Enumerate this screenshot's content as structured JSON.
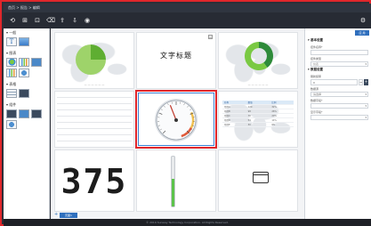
{
  "breadcrumb": "首页 > 报告 > 编辑",
  "toolbar": {
    "buttons": [
      {
        "name": "undo-button",
        "glyph": "⟲"
      },
      {
        "name": "new-page-button",
        "glyph": "⊞"
      },
      {
        "name": "preview-button",
        "glyph": "⊡"
      },
      {
        "name": "clear-button",
        "glyph": "⌫"
      },
      {
        "name": "import-button",
        "glyph": "⇪"
      },
      {
        "name": "export-button",
        "glyph": "⇩"
      },
      {
        "name": "view-button",
        "glyph": "◉"
      }
    ],
    "settings_glyph": "⚙"
  },
  "left_panel": {
    "sections": [
      {
        "title": "▾ 一般",
        "items": [
          {
            "name": "text-tool-icon",
            "glyph": "T",
            "cls": ""
          },
          {
            "name": "image-tool-icon",
            "glyph": "",
            "cls": "img"
          }
        ]
      },
      {
        "title": "▾ 图表",
        "items": [
          {
            "name": "pie-chart-tool-icon",
            "glyph": "",
            "cls": "pie"
          },
          {
            "name": "bar-chart-tool-icon",
            "glyph": "",
            "cls": "chart"
          },
          {
            "name": "gauge-chart-tool-icon",
            "glyph": "",
            "cls": "blue"
          },
          {
            "name": "line-chart-tool-icon",
            "glyph": "",
            "cls": "chart"
          },
          {
            "name": "map-chart-tool-icon",
            "glyph": "",
            "cls": "globe"
          }
        ]
      },
      {
        "title": "▾ 表格",
        "items": [
          {
            "name": "table-tool-icon",
            "glyph": "",
            "cls": "tbl"
          },
          {
            "name": "grid-table-tool-icon",
            "glyph": "",
            "cls": "dark"
          }
        ]
      },
      {
        "title": "▾ 组件",
        "items": [
          {
            "name": "component-tool-icon",
            "glyph": "",
            "cls": "dark"
          },
          {
            "name": "component-2-tool-icon",
            "glyph": "",
            "cls": "blue"
          },
          {
            "name": "component-3-tool-icon",
            "glyph": "",
            "cls": "dark"
          },
          {
            "name": "component-4-tool-icon",
            "glyph": "",
            "cls": "globe"
          }
        ]
      }
    ]
  },
  "canvas": {
    "text_widget_title": "文字标题",
    "led_value": "375",
    "table_rows": [
      [
        "名称",
        "数值",
        "比例"
      ],
      [
        "项目A",
        "120",
        "32%"
      ],
      [
        "项目B",
        "98",
        "26%"
      ],
      [
        "项目C",
        "76",
        "20%"
      ],
      [
        "项目D",
        "54",
        "14%"
      ],
      [
        "项目E",
        "30",
        "8%"
      ]
    ],
    "gauge_value": 0.42,
    "thermometer_level": 0.55,
    "pie_segments": [
      0.25,
      0.75
    ],
    "donut_segments": [
      0.4,
      0.6
    ],
    "tab_label": "页面1"
  },
  "right_panel": {
    "apply_label": "应 用",
    "sections": [
      {
        "title": "▾ 基本设置",
        "fields": [
          {
            "label": "控件名称*",
            "value": ""
          },
          {
            "label": "控件类型",
            "value": "仪表",
            "dropdown": true
          }
        ]
      },
      {
        "title": "▾ 数据设置",
        "fields": [
          {
            "label": "刷新频率",
            "value": "0",
            "stepper": true
          },
          {
            "label": "数据源",
            "value": "请选择",
            "dropdown": true
          },
          {
            "label": "数据字段*",
            "value": "",
            "dropdown": true
          },
          {
            "label": "显示字段*",
            "value": "",
            "dropdown": true
          }
        ]
      }
    ]
  },
  "footer": "© 2019 Sunway Technology Corporation. All Rights Reserved.",
  "colors": {
    "accent": "#2f6fbd",
    "selection": "#e0262b",
    "frame": "#e0262b",
    "chart_green": "#7ac943",
    "chart_dark_green": "#2e8b3a"
  }
}
